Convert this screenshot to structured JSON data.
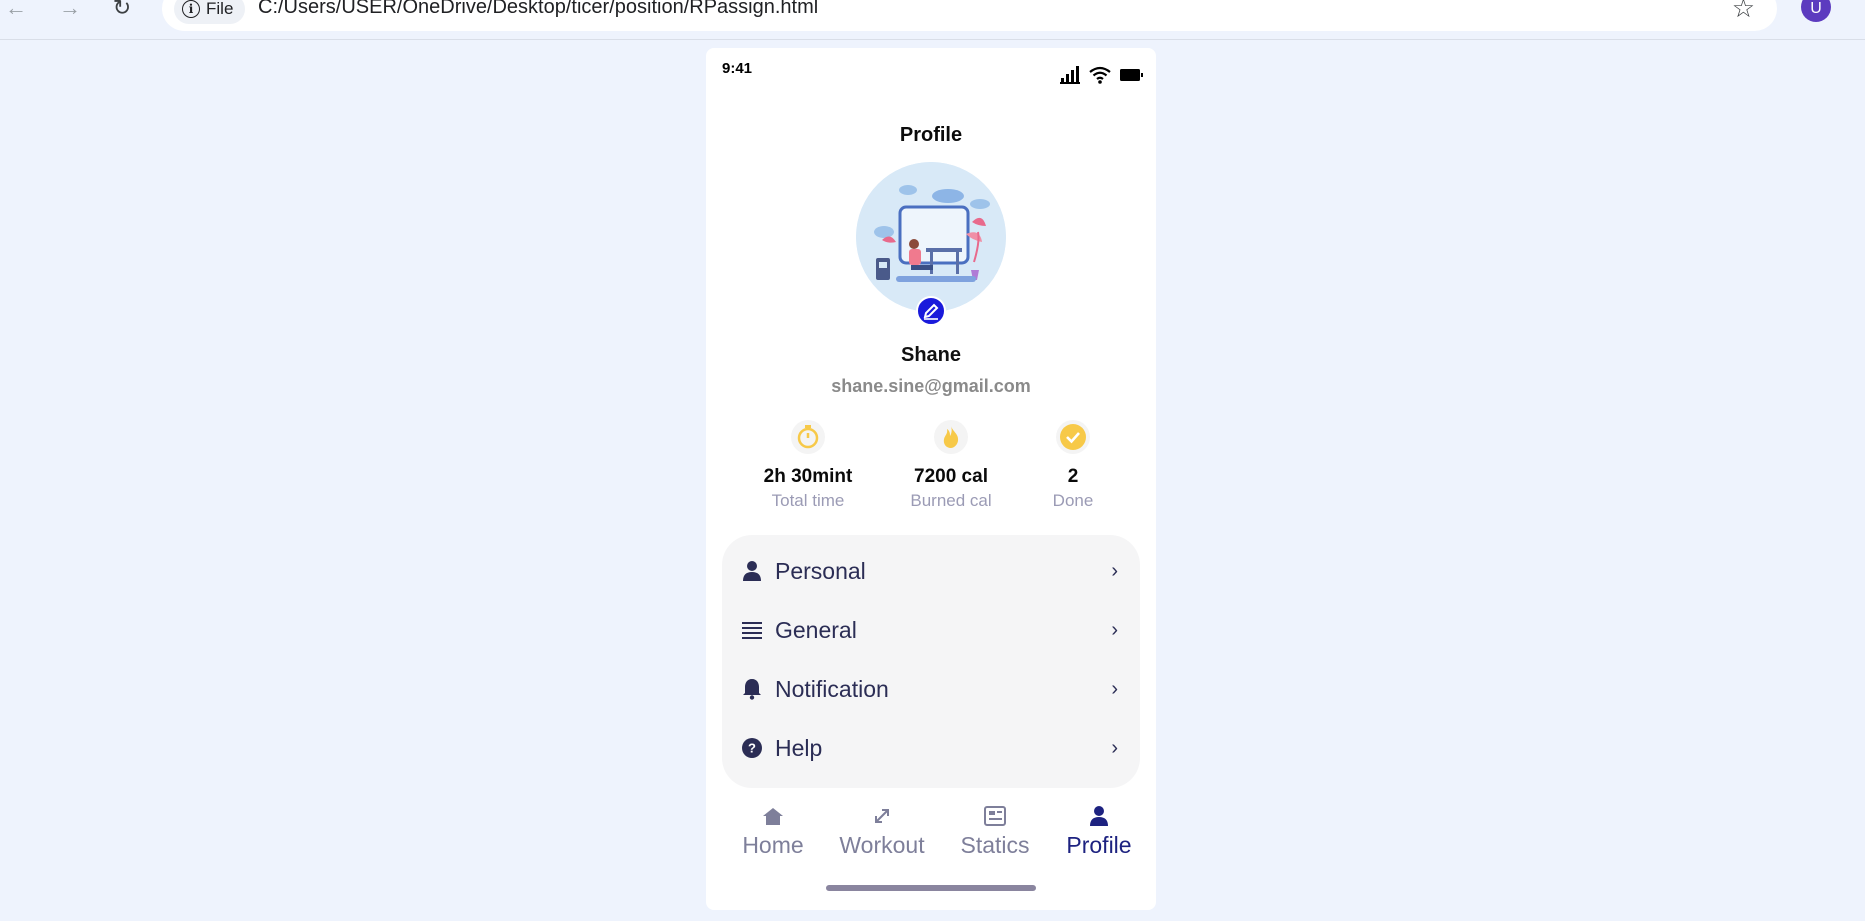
{
  "browser": {
    "back_icon": "←",
    "forward_icon": "→",
    "reload_icon": "↻",
    "file_label": "File",
    "url": "C:/Users/USER/OneDrive/Desktop/ticer/position/RPassign.html",
    "avatar_letter": "U"
  },
  "status_bar": {
    "time": "9:41"
  },
  "profile": {
    "title": "Profile",
    "name": "Shane",
    "email": "shane.sine@gmail.com"
  },
  "stats": [
    {
      "value": "2h 30mint",
      "label": "Total time",
      "icon": "stopwatch-icon"
    },
    {
      "value": "7200 cal",
      "label": "Burned cal",
      "icon": "flame-icon"
    },
    {
      "value": "2",
      "label": "Done",
      "icon": "check-circle-icon"
    }
  ],
  "menu": [
    {
      "label": "Personal",
      "icon": "person-icon"
    },
    {
      "label": "General",
      "icon": "list-icon"
    },
    {
      "label": "Notification",
      "icon": "bell-icon"
    },
    {
      "label": "Help",
      "icon": "help-icon"
    }
  ],
  "tabs": [
    {
      "label": "Home",
      "icon": "home-icon",
      "active": false
    },
    {
      "label": "Workout",
      "icon": "expand-icon",
      "active": false
    },
    {
      "label": "Statics",
      "icon": "news-icon",
      "active": false
    },
    {
      "label": "Profile",
      "icon": "person-icon",
      "active": true
    }
  ],
  "colors": {
    "accent": "#1d2280",
    "edit_button": "#1a1adb",
    "stat_icon": "#f7c948",
    "page_background": "#eef3fd"
  }
}
